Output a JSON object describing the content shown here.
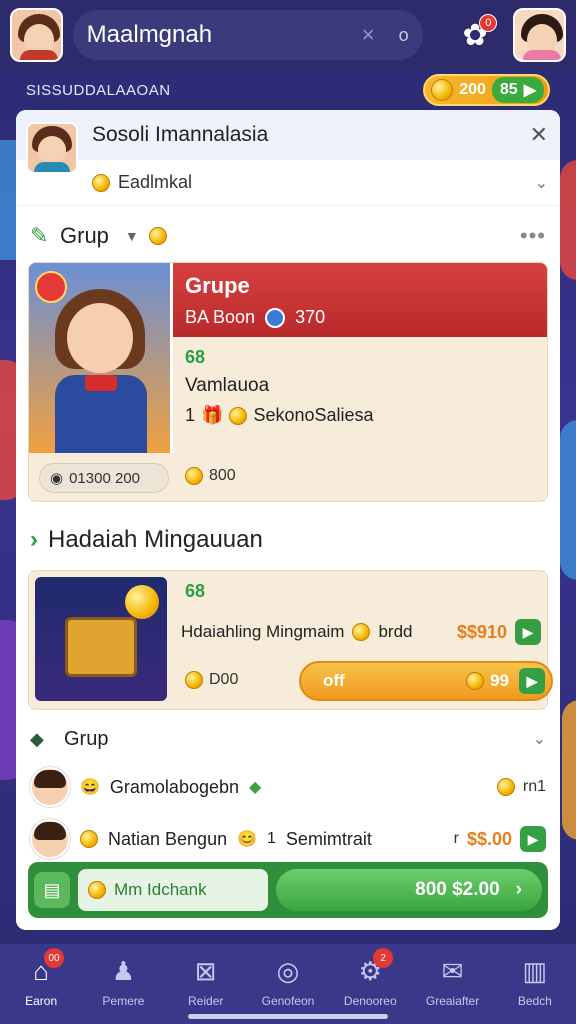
{
  "topbar": {
    "title": "Maalmgnah",
    "clear_icon": "×",
    "mic_icon": "o",
    "gift_badge": "0"
  },
  "subheader": {
    "label": "SISSUDDALAAOAN",
    "coins": "200",
    "bonus": "85"
  },
  "card": {
    "title": "Sosoli Imannalasia",
    "subtitle": "Eadlmkal",
    "section1": {
      "title": "Grup"
    },
    "grup_card": {
      "title": "Grupe",
      "line2_a": "BA Boon",
      "line2_b": "370",
      "number": "68",
      "name": "Vamlauoa",
      "line5_prefix": "1",
      "line5_text": "SekonoSaliesa",
      "pill_text": "01300 200",
      "coins": "800"
    },
    "hadiah": {
      "title": "Hadaiah Mingauuan",
      "number": "68",
      "line": "Hdaiahling Mingmaim",
      "line_tail": "brdd",
      "price": "$$910",
      "coins": "D00",
      "bar_label": "off",
      "bar_value": "99"
    },
    "section2": {
      "title": "Grup"
    },
    "list": [
      {
        "name": "Gramolabogebn",
        "right": "rn1"
      },
      {
        "name": "Natian Bengun",
        "mid1": "1",
        "mid2": "Semimtrait",
        "mid3": "r",
        "price": "$$.00"
      }
    ],
    "strip": {
      "input_text": "Mm Idchank",
      "button_text": "800 $2.00"
    }
  },
  "nav": [
    {
      "label": "Earon",
      "icon": "home-icon",
      "badge": "00"
    },
    {
      "label": "Pemere",
      "icon": "person-icon"
    },
    {
      "label": "Reider",
      "icon": "box-icon"
    },
    {
      "label": "Genofeon",
      "icon": "compass-icon"
    },
    {
      "label": "Denooreo",
      "icon": "gear-icon",
      "badge": "2"
    },
    {
      "label": "Greaiafter",
      "icon": "mail-icon"
    },
    {
      "label": "Bedch",
      "icon": "book-icon"
    }
  ]
}
